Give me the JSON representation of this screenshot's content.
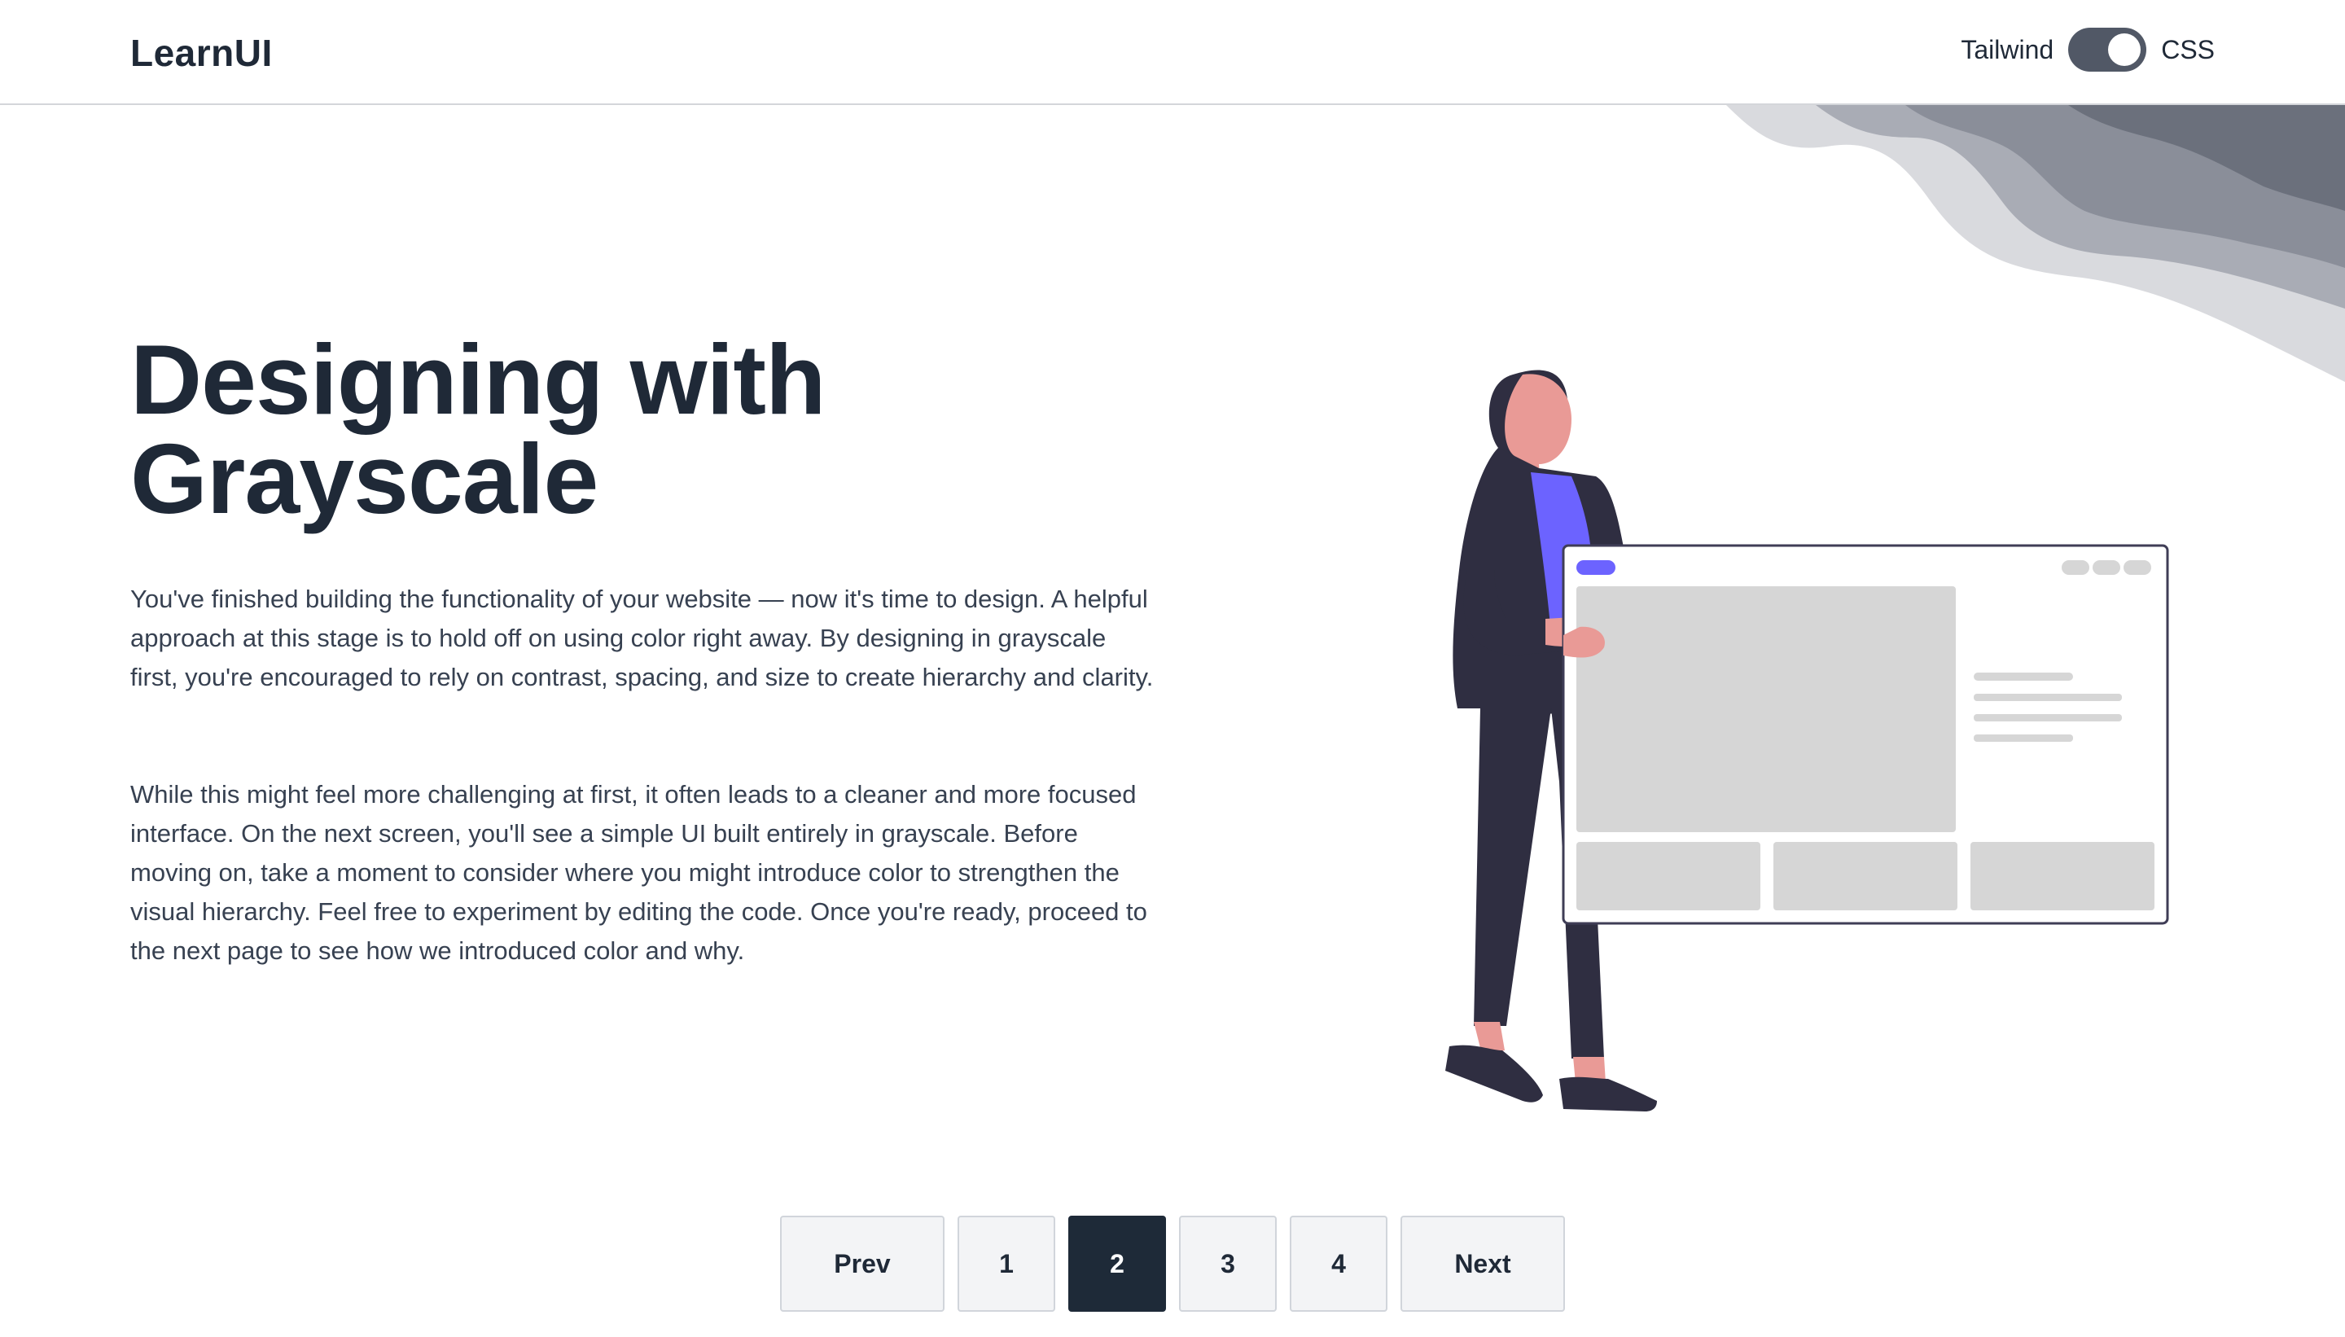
{
  "header": {
    "logo": "LearnUI",
    "toggle": {
      "left_label": "Tailwind",
      "right_label": "CSS",
      "state": "CSS"
    }
  },
  "hero": {
    "title_line1": "Designing with",
    "title_line2": "Grayscale",
    "paragraph1": "You've finished building the functionality of your website — now it's time to design. A helpful approach at this stage is to hold off on using color right away. By designing in grayscale first, you're encouraged to rely on contrast, spacing, and size to create hierarchy and clarity.",
    "paragraph2": "While this might feel more challenging at first, it often leads to a cleaner and more focused interface. On the next screen, you'll see a simple UI built entirely in grayscale. Before moving on, take a moment to consider where you might introduce color to strengthen the visual hierarchy. Feel free to experiment by editing the code. Once you're ready, proceed to the next page to see how we introduced color and why."
  },
  "pagination": {
    "prev_label": "Prev",
    "next_label": "Next",
    "pages": [
      "1",
      "2",
      "3",
      "4"
    ],
    "current": "2"
  },
  "colors": {
    "text_dark": "#1f2937",
    "active_page": "#1e2a38",
    "accent_purple": "#6c63ff",
    "skin": "#e99a96",
    "clothing": "#2f2e41"
  }
}
